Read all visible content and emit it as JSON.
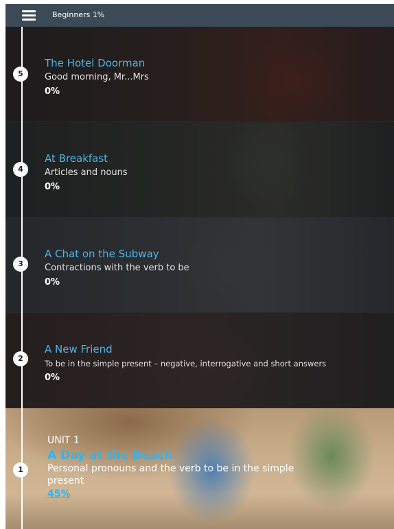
{
  "header": {
    "title": "Beginners 1%"
  },
  "lessons": [
    {
      "number": "5",
      "title": "The Hotel Doorman",
      "subtitle": "Good morning, Mr...Mrs",
      "percent": "0%"
    },
    {
      "number": "4",
      "title": "At Breakfast",
      "subtitle": "Articles and nouns",
      "percent": "0%"
    },
    {
      "number": "3",
      "title": "A Chat on the Subway",
      "subtitle": "Contractions with the verb to be",
      "percent": "0%"
    },
    {
      "number": "2",
      "title": "A New Friend",
      "subtitle": "To be in the simple present – negative, interrogative and short answers",
      "percent": "0%"
    }
  ],
  "unit": {
    "number": "1",
    "label": "UNIT 1",
    "title": "A Day at the Beach",
    "subtitle": "Personal pronouns and the verb to be in the simple present",
    "percent": "45%"
  },
  "colors": {
    "topbar": "#3b4a56",
    "accent": "#4fb3e6",
    "unit_accent": "#2fb5ef"
  },
  "icons": {
    "menu": "hamburger-menu-icon"
  }
}
